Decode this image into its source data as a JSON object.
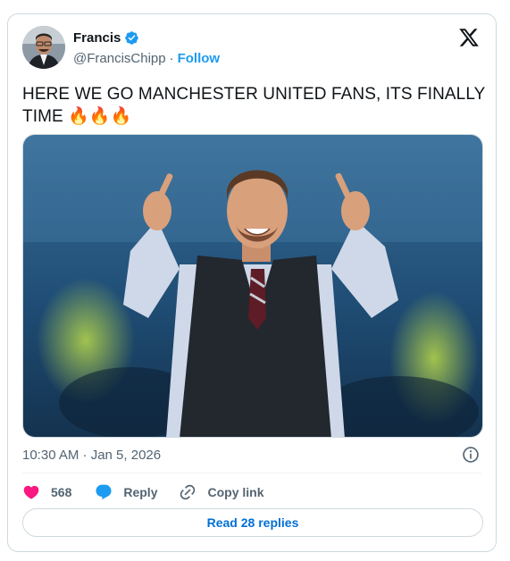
{
  "author": {
    "name": "Francis",
    "handle": "@FrancisChipp",
    "separator": "·",
    "follow_label": "Follow",
    "verified_color": "#1d9bf0"
  },
  "tweet": {
    "text": "HERE WE GO MANCHESTER UNITED FANS, ITS FINALLY TIME 🔥🔥🔥",
    "timestamp": "10:30 AM · Jan 5, 2026"
  },
  "actions": {
    "like_count": "568",
    "reply_label": "Reply",
    "copy_link_label": "Copy link"
  },
  "read_replies_label": "Read 28 replies",
  "icons": [
    "x-logo-icon",
    "verified-badge-icon",
    "info-icon",
    "heart-icon",
    "reply-bubble-icon",
    "link-icon"
  ],
  "colors": {
    "accent": "#1d9bf0",
    "like": "#f91880",
    "text_secondary": "#536471",
    "link": "#006fd6"
  }
}
